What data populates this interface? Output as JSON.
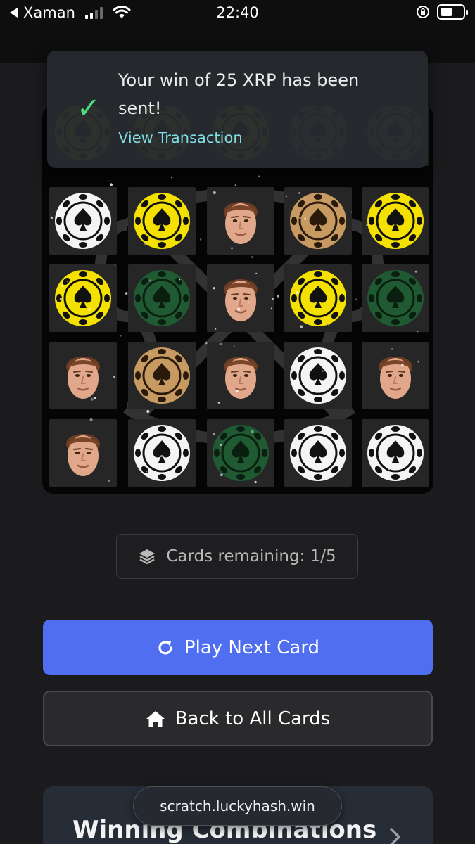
{
  "status_bar": {
    "back_app": "Xaman",
    "time": "22:40",
    "battery_level": 0.55
  },
  "toast": {
    "message": "Your win of 25 XRP has been sent!",
    "link": "View Transaction",
    "icon": "check-icon",
    "accent": "#4ade80",
    "link_color": "#7fdde6"
  },
  "board": {
    "cell_types": [
      "white-chip",
      "yellow-chip",
      "tan-chip",
      "green-chip",
      "face"
    ],
    "rows": [
      [
        "white-chip",
        "yellow-chip",
        "face",
        "tan-chip",
        "yellow-chip"
      ],
      [
        "yellow-chip",
        "green-chip",
        "face",
        "yellow-chip",
        "green-chip"
      ],
      [
        "face",
        "tan-chip",
        "face",
        "white-chip",
        "face"
      ],
      [
        "face",
        "white-chip",
        "green-chip",
        "white-chip",
        "white-chip"
      ]
    ],
    "top_row_partial": [
      "yellow-chip",
      "yellow-chip",
      "yellow-chip",
      "tan-chip",
      "tan-chip"
    ]
  },
  "remaining": {
    "label": "Cards remaining: 1/5",
    "icon": "layers-icon"
  },
  "buttons": {
    "play_next": "Play Next Card",
    "play_next_icon": "refresh-icon",
    "back": "Back to All Cards",
    "back_icon": "home-icon",
    "primary_color": "#4f6ef0"
  },
  "combos": {
    "title": "Winning Combinations"
  },
  "url": "scratch.luckyhash.win"
}
